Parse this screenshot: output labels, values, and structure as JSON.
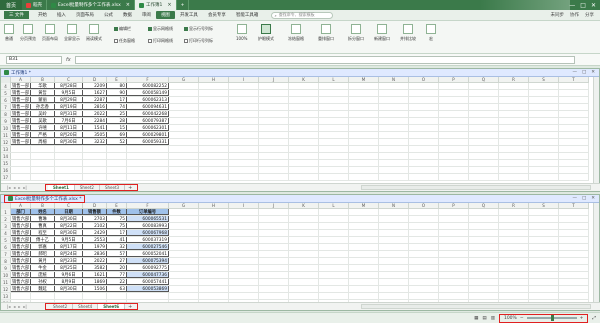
{
  "titlebar": {
    "home": "首页",
    "tabs": [
      {
        "label": "稻壳",
        "active": false
      },
      {
        "label": "Excel批量制作多个工作表.xlsx",
        "active": false
      },
      {
        "label": "工作簿1",
        "active": true
      }
    ],
    "window_controls": [
      "—",
      "□",
      "✕"
    ]
  },
  "menubar": {
    "file": "三 文件",
    "items": [
      "开始",
      "插入",
      "页面布局",
      "公式",
      "数据",
      "审阅",
      "视图",
      "开发工具",
      "会员专享",
      "智能工具箱"
    ],
    "active_item": "视图",
    "search_placeholder": "查找命令、搜索模板",
    "right_items": [
      "未同步",
      "协作",
      "分享"
    ]
  },
  "ribbon": {
    "buttons": [
      "普通",
      "分页预览",
      "页面布局",
      "全屏显示",
      "阅读模式",
      "护眼模式",
      "冻结窗格",
      "重排窗口",
      "拆分窗口",
      "新建窗口",
      "并排比较",
      "宏"
    ],
    "checks": [
      {
        "label": "编辑栏",
        "on": true
      },
      {
        "label": "显示网格线",
        "on": true
      },
      {
        "label": "显示行号列标",
        "on": true
      },
      {
        "label": "任务窗格",
        "on": false
      },
      {
        "label": "打印网格线",
        "on": false
      },
      {
        "label": "打印行号列标",
        "on": false
      }
    ]
  },
  "formulabar": {
    "namebox": "B31",
    "fx": "fx"
  },
  "columns": [
    "A",
    "B",
    "C",
    "D",
    "E",
    "F",
    "G",
    "H",
    "I",
    "J",
    "K",
    "L",
    "M",
    "N",
    "O",
    "P",
    "Q",
    "R",
    "S",
    "T"
  ],
  "window1": {
    "title": "工作簿1 *",
    "row_numbers": [
      "4",
      "5",
      "6",
      "7",
      "8",
      "9",
      "10",
      "11",
      "12",
      "13",
      "14",
      "15",
      "16",
      "17"
    ],
    "rows": [
      [
        "销售一部",
        "华歌",
        "8月28日",
        "2209",
        "80",
        "600082252"
      ],
      [
        "销售一部",
        "黄哲",
        "9月5日",
        "1627",
        "90",
        "600058149"
      ],
      [
        "销售一部",
        "蒙丽",
        "8月29日",
        "2287",
        "17",
        "600062313"
      ],
      [
        "销售一部",
        "孙忠香",
        "8月19日",
        "2816",
        "74",
        "600094631"
      ],
      [
        "销售一部",
        "吴岭",
        "8月31日",
        "2022",
        "25",
        "600042268"
      ],
      [
        "销售一部",
        "吴歌",
        "7月6日",
        "2284",
        "28",
        "600079387"
      ],
      [
        "销售一部",
        "许嘻",
        "8月11日",
        "1541",
        "15",
        "600062301"
      ],
      [
        "销售一部",
        "严格",
        "8月20日",
        "3505",
        "69",
        "600029801"
      ],
      [
        "销售一部",
        "周榕",
        "8月30日",
        "3232",
        "52",
        "600059331"
      ]
    ],
    "sheets": [
      "Sheet1",
      "Sheet2",
      "Sheet3"
    ],
    "active_sheet": "Sheet1"
  },
  "window2": {
    "title": "Excel批量制作多个工作表.xlsx *",
    "row_numbers": [
      "1",
      "2",
      "3",
      "4",
      "5",
      "6",
      "7",
      "8",
      "9",
      "10",
      "11",
      "12",
      "13",
      "14"
    ],
    "header": [
      "部门",
      "姓名",
      "日期",
      "销售额",
      "件数",
      "订单编号"
    ],
    "rows": [
      [
        "销售六部",
        "曹琳",
        "8月30日",
        "2703",
        "75",
        "600065531"
      ],
      [
        "销售六部",
        "曹真",
        "8月22日",
        "2102",
        "75",
        "600083993"
      ],
      [
        "销售六部",
        "程至",
        "8月30日",
        "2429",
        "17",
        "600067968"
      ],
      [
        "销售六部",
        "傅十乙",
        "9月5日",
        "2553",
        "41",
        "600037319"
      ],
      [
        "销售六部",
        "郭嘉",
        "8月17日",
        "1979",
        "32",
        "600027546"
      ],
      [
        "销售六部",
        "郝昭",
        "8月24日",
        "2836",
        "57",
        "600052041"
      ],
      [
        "销售六部",
        "黄月",
        "8月23日",
        "2022",
        "27",
        "600075394"
      ],
      [
        "销售六部",
        "牛金",
        "8月25日",
        "3582",
        "20",
        "600092775"
      ],
      [
        "销售六部",
        "庞统",
        "9月6日",
        "1621",
        "77",
        "600047736"
      ],
      [
        "销售六部",
        "孙权",
        "8月9日",
        "1869",
        "22",
        "600057441"
      ],
      [
        "销售六部",
        "魏延",
        "8月30日",
        "1506",
        "63",
        "600053869"
      ]
    ],
    "sheets": [
      "Sheet2",
      "Sheet4",
      "Sheet6"
    ],
    "active_sheet": "Sheet6"
  },
  "statusbar": {
    "zoom": "100%"
  }
}
